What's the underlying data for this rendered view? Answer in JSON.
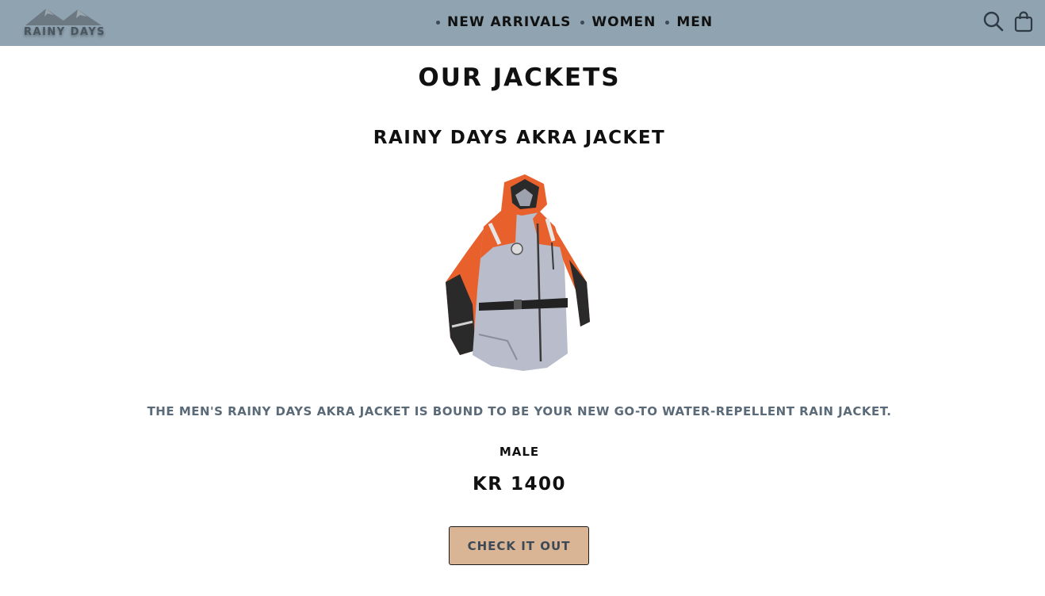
{
  "header": {
    "logo_text": "RAINY DAYS",
    "nav": [
      {
        "label": "NEW ARRIVALS"
      },
      {
        "label": "WOMEN"
      },
      {
        "label": "MEN"
      }
    ],
    "icons": [
      "search-icon",
      "shopping-bag-icon"
    ]
  },
  "main": {
    "page_title": "OUR JACKETS",
    "product": {
      "title": "RAINY DAYS AKRA JACKET",
      "image_icon": "jacket-image",
      "description": "THE MEN'S RAINY DAYS AKRA JACKET IS BOUND TO BE YOUR NEW GO-TO WATER-REPELLENT RAIN JACKET.",
      "gender": "MALE",
      "price": "KR 1400",
      "cta_label": "CHECK IT OUT"
    }
  },
  "colors": {
    "header_bg": "#8fa3b0",
    "cta_bg": "#d9b596",
    "description_text": "#5b6a78",
    "jacket_orange": "#e8612c",
    "jacket_gray": "#b8bccb"
  }
}
